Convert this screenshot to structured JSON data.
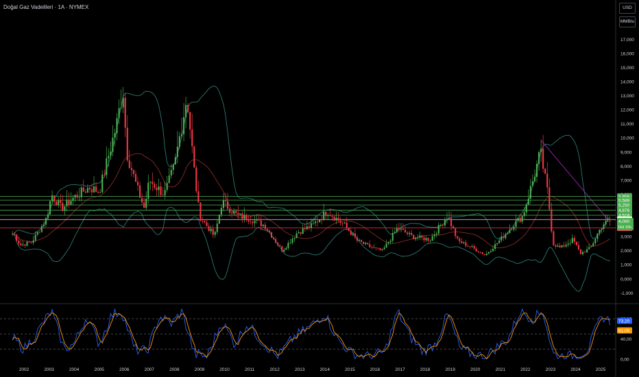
{
  "header": {
    "title": "Doğal Gaz Vadelileri · 1A · NYMEX",
    "currency": "USD",
    "unit": "MMBtu"
  },
  "colors": {
    "up": "#26a69a",
    "up_bright": "#4caf50",
    "down": "#f23645",
    "bb_band": "#2a7a72",
    "bb_mid": "#8b2a2a",
    "level_green": "#4caf50",
    "level_white": "#d1d4dc",
    "level_red": "#f23645",
    "stoch_k": "#2962ff",
    "stoch_d": "#ff9800",
    "trend": "#9c27b0"
  },
  "chart_data": [
    {
      "type": "candlestick",
      "title": "Doğal Gaz Vadelileri · 1A · NYMEX",
      "x_ticks": [
        "2002",
        "2003",
        "2004",
        "2005",
        "2006",
        "2007",
        "2008",
        "2009",
        "2010",
        "2011",
        "2012",
        "2013",
        "2014",
        "2015",
        "2016",
        "2017",
        "2018",
        "2019",
        "2020",
        "2021",
        "2022",
        "2023",
        "2024",
        "2025"
      ],
      "y_ticks": [
        "17,000",
        "16,000",
        "15,000",
        "14,000",
        "13,000",
        "12,000",
        "11,000",
        "10,000",
        "9,000",
        "8,000",
        "7,000",
        "6,000",
        "5,000",
        "4,000",
        "3,000",
        "2,000",
        "1,000",
        "0,000",
        "-1,000"
      ],
      "ylim": [
        -1.0,
        17.0
      ],
      "close_series_approx": [
        {
          "x": 2001.6,
          "y": 3.2
        },
        {
          "x": 2001.85,
          "y": 2.4
        },
        {
          "x": 2002.3,
          "y": 2.6
        },
        {
          "x": 2002.9,
          "y": 4.3
        },
        {
          "x": 2003.1,
          "y": 6.0
        },
        {
          "x": 2003.5,
          "y": 5.0
        },
        {
          "x": 2004.0,
          "y": 5.8
        },
        {
          "x": 2004.6,
          "y": 6.5
        },
        {
          "x": 2005.0,
          "y": 6.2
        },
        {
          "x": 2005.7,
          "y": 11.0
        },
        {
          "x": 2005.95,
          "y": 13.5
        },
        {
          "x": 2006.1,
          "y": 9.0
        },
        {
          "x": 2006.5,
          "y": 6.5
        },
        {
          "x": 2006.8,
          "y": 5.0
        },
        {
          "x": 2007.0,
          "y": 7.0
        },
        {
          "x": 2007.6,
          "y": 6.0
        },
        {
          "x": 2008.0,
          "y": 8.0
        },
        {
          "x": 2008.5,
          "y": 13.0
        },
        {
          "x": 2008.8,
          "y": 7.5
        },
        {
          "x": 2009.0,
          "y": 4.5
        },
        {
          "x": 2009.6,
          "y": 3.0
        },
        {
          "x": 2009.9,
          "y": 5.5
        },
        {
          "x": 2010.5,
          "y": 4.5
        },
        {
          "x": 2011.0,
          "y": 4.3
        },
        {
          "x": 2011.6,
          "y": 3.8
        },
        {
          "x": 2012.3,
          "y": 2.0
        },
        {
          "x": 2012.9,
          "y": 3.3
        },
        {
          "x": 2013.5,
          "y": 3.8
        },
        {
          "x": 2014.1,
          "y": 4.8
        },
        {
          "x": 2014.8,
          "y": 3.8
        },
        {
          "x": 2015.3,
          "y": 2.7
        },
        {
          "x": 2015.9,
          "y": 2.2
        },
        {
          "x": 2016.3,
          "y": 2.0
        },
        {
          "x": 2016.9,
          "y": 3.6
        },
        {
          "x": 2017.5,
          "y": 3.0
        },
        {
          "x": 2018.2,
          "y": 2.8
        },
        {
          "x": 2018.9,
          "y": 4.5
        },
        {
          "x": 2019.3,
          "y": 2.7
        },
        {
          "x": 2019.9,
          "y": 2.2
        },
        {
          "x": 2020.4,
          "y": 1.7
        },
        {
          "x": 2020.9,
          "y": 2.6
        },
        {
          "x": 2021.5,
          "y": 3.8
        },
        {
          "x": 2021.9,
          "y": 4.5
        },
        {
          "x": 2022.3,
          "y": 7.0
        },
        {
          "x": 2022.6,
          "y": 9.0
        },
        {
          "x": 2022.9,
          "y": 6.0
        },
        {
          "x": 2023.1,
          "y": 2.5
        },
        {
          "x": 2023.4,
          "y": 2.2
        },
        {
          "x": 2023.9,
          "y": 2.8
        },
        {
          "x": 2024.2,
          "y": 1.8
        },
        {
          "x": 2024.6,
          "y": 2.2
        },
        {
          "x": 2024.9,
          "y": 3.3
        },
        {
          "x": 2025.1,
          "y": 3.9
        },
        {
          "x": 2025.4,
          "y": 4.09
        }
      ],
      "horizontal_levels": [
        {
          "value": 5.856,
          "label": "5,856",
          "color": "green"
        },
        {
          "value": 5.589,
          "label": "5,589",
          "color": "green"
        },
        {
          "value": 5.25,
          "label": "5,250",
          "color": "green"
        },
        {
          "value": 4.876,
          "label": "4,876",
          "color": "green"
        },
        {
          "value": 4.519,
          "label": "4,519",
          "color": "green"
        },
        {
          "value": 4.216,
          "label": "4,216",
          "color": "white"
        },
        {
          "value": 3.623,
          "label": "3,623",
          "color": "red"
        }
      ],
      "last_price": {
        "value": 4.09,
        "label": "4,090",
        "countdown": "16d 15h"
      }
    },
    {
      "type": "line",
      "name": "stochastic",
      "y_ticks": [
        "80,00",
        "40,00",
        "0,00"
      ],
      "ylim": [
        0,
        100
      ],
      "guides": [
        80,
        50,
        20
      ],
      "series": [
        {
          "key": "k",
          "last": 73.2,
          "label": "73,20"
        },
        {
          "key": "d",
          "last": 61.06,
          "label": "61,06"
        }
      ],
      "k_series_approx": [
        {
          "x": 2001.6,
          "y": 40
        },
        {
          "x": 2002.0,
          "y": 20
        },
        {
          "x": 2002.5,
          "y": 50
        },
        {
          "x": 2002.8,
          "y": 75
        },
        {
          "x": 2003.1,
          "y": 95
        },
        {
          "x": 2003.6,
          "y": 20
        },
        {
          "x": 2004.0,
          "y": 30
        },
        {
          "x": 2004.5,
          "y": 85
        },
        {
          "x": 2005.0,
          "y": 30
        },
        {
          "x": 2005.5,
          "y": 88
        },
        {
          "x": 2005.9,
          "y": 95
        },
        {
          "x": 2006.4,
          "y": 20
        },
        {
          "x": 2006.9,
          "y": 15
        },
        {
          "x": 2007.4,
          "y": 85
        },
        {
          "x": 2007.9,
          "y": 70
        },
        {
          "x": 2008.3,
          "y": 95
        },
        {
          "x": 2008.8,
          "y": 10
        },
        {
          "x": 2009.3,
          "y": 5
        },
        {
          "x": 2009.9,
          "y": 75
        },
        {
          "x": 2010.4,
          "y": 30
        },
        {
          "x": 2010.9,
          "y": 70
        },
        {
          "x": 2011.5,
          "y": 35
        },
        {
          "x": 2012.1,
          "y": 5
        },
        {
          "x": 2012.8,
          "y": 45
        },
        {
          "x": 2013.3,
          "y": 60
        },
        {
          "x": 2014.0,
          "y": 90
        },
        {
          "x": 2014.5,
          "y": 40
        },
        {
          "x": 2015.1,
          "y": 10
        },
        {
          "x": 2015.8,
          "y": 5
        },
        {
          "x": 2016.4,
          "y": 15
        },
        {
          "x": 2016.9,
          "y": 95
        },
        {
          "x": 2017.4,
          "y": 45
        },
        {
          "x": 2017.9,
          "y": 15
        },
        {
          "x": 2018.4,
          "y": 30
        },
        {
          "x": 2018.9,
          "y": 90
        },
        {
          "x": 2019.4,
          "y": 20
        },
        {
          "x": 2019.9,
          "y": 10
        },
        {
          "x": 2020.4,
          "y": 5
        },
        {
          "x": 2020.9,
          "y": 25
        },
        {
          "x": 2021.3,
          "y": 40
        },
        {
          "x": 2021.8,
          "y": 95
        },
        {
          "x": 2022.3,
          "y": 80
        },
        {
          "x": 2022.7,
          "y": 95
        },
        {
          "x": 2023.1,
          "y": 10
        },
        {
          "x": 2023.6,
          "y": 5
        },
        {
          "x": 2024.1,
          "y": 8
        },
        {
          "x": 2024.5,
          "y": 20
        },
        {
          "x": 2024.9,
          "y": 70
        },
        {
          "x": 2025.1,
          "y": 85
        },
        {
          "x": 2025.4,
          "y": 73
        }
      ]
    }
  ]
}
